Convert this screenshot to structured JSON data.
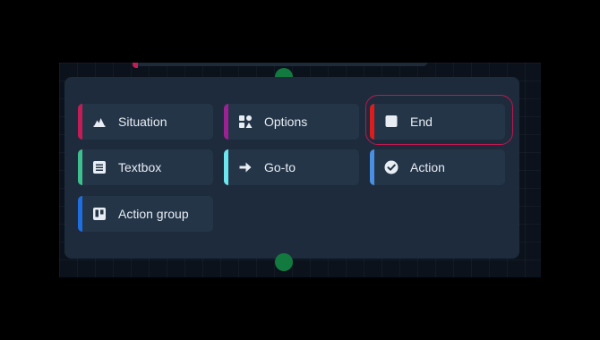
{
  "nodes": [
    {
      "label": "Situation",
      "icon": "situation-icon",
      "color": "#c41c56"
    },
    {
      "label": "Options",
      "icon": "options-icon",
      "color": "#9c2192"
    },
    {
      "label": "End",
      "icon": "end-icon",
      "color": "#e01b1b",
      "selected": true
    },
    {
      "label": "Textbox",
      "icon": "textbox-icon",
      "color": "#3fbf8f"
    },
    {
      "label": "Go-to",
      "icon": "arrow-right-icon",
      "color": "#6ce6ee"
    },
    {
      "label": "Action",
      "icon": "check-circle-icon",
      "color": "#4a90e2"
    },
    {
      "label": "Action group",
      "icon": "action-group-icon",
      "color": "#1e6ee0"
    }
  ],
  "colors": {
    "background": "#000000",
    "canvas": "#0b121c",
    "panel": "#1d2b3c",
    "node": "#243548",
    "connector": "#137a3f",
    "selection": "#c0184f",
    "text": "#e8edf3"
  }
}
